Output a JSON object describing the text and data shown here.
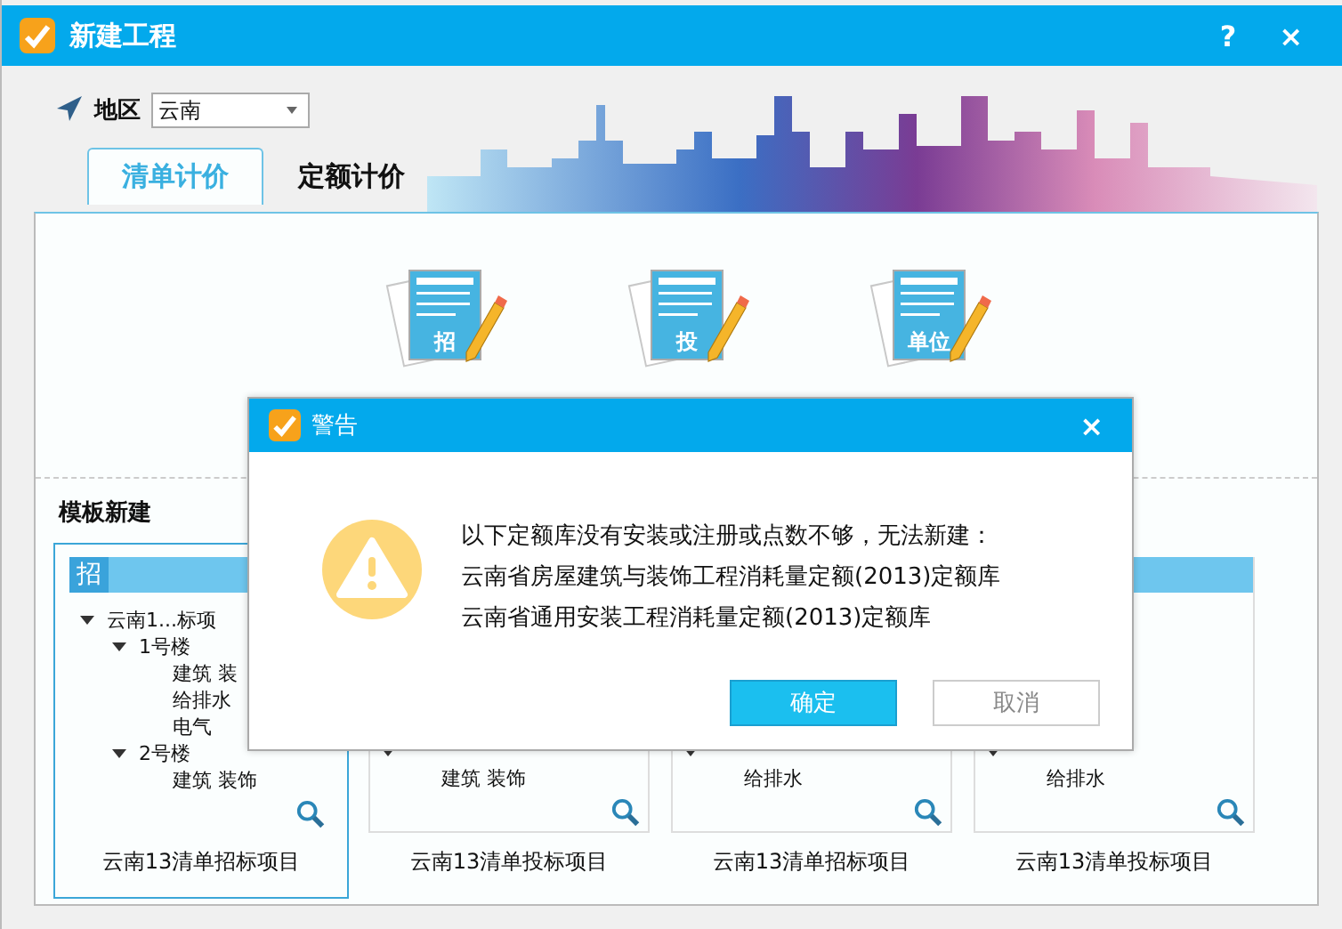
{
  "window": {
    "title": "新建工程",
    "help": "?",
    "close": "×"
  },
  "region": {
    "label": "地区",
    "value": "云南"
  },
  "tabs": [
    {
      "label": "清单计价",
      "selected": true
    },
    {
      "label": "定额计价",
      "selected": false
    }
  ],
  "new_items": [
    {
      "badge": "招"
    },
    {
      "badge": "投"
    },
    {
      "badge": "单位"
    }
  ],
  "templates": {
    "title": "模板新建",
    "cards": [
      {
        "badge": "招",
        "selected": true,
        "caption": "云南13清单招标项目",
        "tree": [
          {
            "label": "云南1...标项",
            "expanded": true,
            "children": [
              {
                "label": "1号楼",
                "expanded": true,
                "children": [
                  {
                    "label": "建筑 装"
                  },
                  {
                    "label": "给排水"
                  },
                  {
                    "label": "电气"
                  }
                ]
              },
              {
                "label": "2号楼",
                "expanded": true,
                "children": [
                  {
                    "label": "建筑 装饰"
                  }
                ]
              }
            ]
          }
        ]
      },
      {
        "selected": false,
        "caption": "云南13清单投标项目",
        "tree": [
          {
            "expanded": true,
            "children": [
              {
                "label": "建筑 装饰"
              }
            ]
          }
        ]
      },
      {
        "selected": false,
        "caption": "云南13清单招标项目",
        "tree": [
          {
            "expanded": true,
            "children": [
              {
                "label": "给排水"
              }
            ]
          }
        ]
      },
      {
        "selected": false,
        "caption": "云南13清单投标项目",
        "tree": [
          {
            "expanded": true,
            "children": [
              {
                "label": "给排水"
              }
            ]
          }
        ]
      }
    ]
  },
  "dialog": {
    "title": "警告",
    "close": "×",
    "message": [
      "以下定额库没有安装或注册或点数不够，无法新建：",
      "云南省房屋建筑与装饰工程消耗量定额(2013)定额库",
      "云南省通用安装工程消耗量定额(2013)定额库"
    ],
    "buttons": [
      {
        "label": "确定",
        "kind": "primary"
      },
      {
        "label": "取消",
        "kind": "secondary"
      }
    ]
  }
}
